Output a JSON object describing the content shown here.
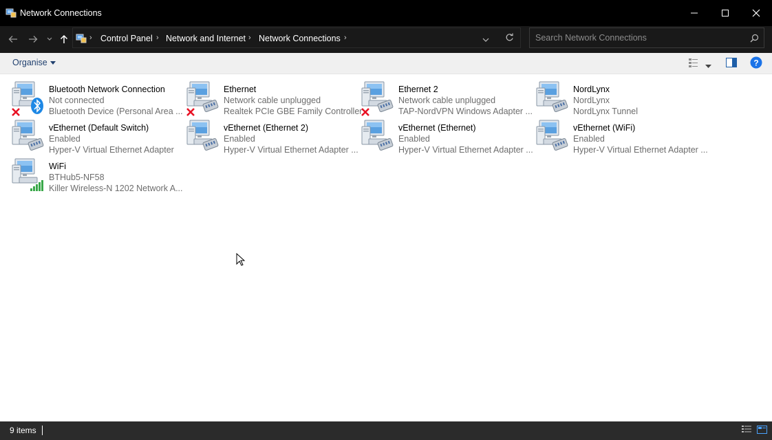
{
  "window": {
    "title": "Network Connections"
  },
  "nav": {
    "breadcrumbs": [
      "Control Panel",
      "Network and Internet",
      "Network Connections"
    ]
  },
  "search": {
    "placeholder": "Search Network Connections"
  },
  "toolbar": {
    "organise_label": "Organise"
  },
  "connections": [
    {
      "name": "Bluetooth Network Connection",
      "status": "Not connected",
      "device": "Bluetooth Device (Personal Area ...",
      "badge": "bluetooth-icon",
      "disconnected": true
    },
    {
      "name": "Ethernet",
      "status": "Network cable unplugged",
      "device": "Realtek PCIe GBE Family Controller",
      "badge": "ethernet-cable-icon",
      "disconnected": true
    },
    {
      "name": "Ethernet 2",
      "status": "Network cable unplugged",
      "device": "TAP-NordVPN Windows Adapter ...",
      "badge": "ethernet-cable-icon",
      "disconnected": true
    },
    {
      "name": "NordLynx",
      "status": "NordLynx",
      "device": "NordLynx Tunnel",
      "badge": "ethernet-cable-icon",
      "disconnected": false
    },
    {
      "name": "vEthernet (Default Switch)",
      "status": "Enabled",
      "device": "Hyper-V Virtual Ethernet Adapter",
      "badge": "ethernet-cable-icon",
      "disconnected": false
    },
    {
      "name": "vEthernet (Ethernet 2)",
      "status": "Enabled",
      "device": "Hyper-V Virtual Ethernet Adapter ...",
      "badge": "ethernet-cable-icon",
      "disconnected": false
    },
    {
      "name": "vEthernet (Ethernet)",
      "status": "Enabled",
      "device": "Hyper-V Virtual Ethernet Adapter ...",
      "badge": "ethernet-cable-icon",
      "disconnected": false
    },
    {
      "name": "vEthernet (WiFi)",
      "status": "Enabled",
      "device": "Hyper-V Virtual Ethernet Adapter ...",
      "badge": "ethernet-cable-icon",
      "disconnected": false
    },
    {
      "name": "WiFi",
      "status": "BTHub5-NF58",
      "device": "Killer Wireless-N 1202 Network A...",
      "badge": "wifi-signal-icon",
      "disconnected": false
    }
  ],
  "statusbar": {
    "item_count": "9 items"
  },
  "colors": {
    "titlebar": "#000000",
    "addressbar": "#191919",
    "toolbar": "#f0f0f0",
    "statusbar": "#2b2b2b",
    "link": "#1f3f6e",
    "error": "#e81123",
    "help": "#1a73e8"
  }
}
